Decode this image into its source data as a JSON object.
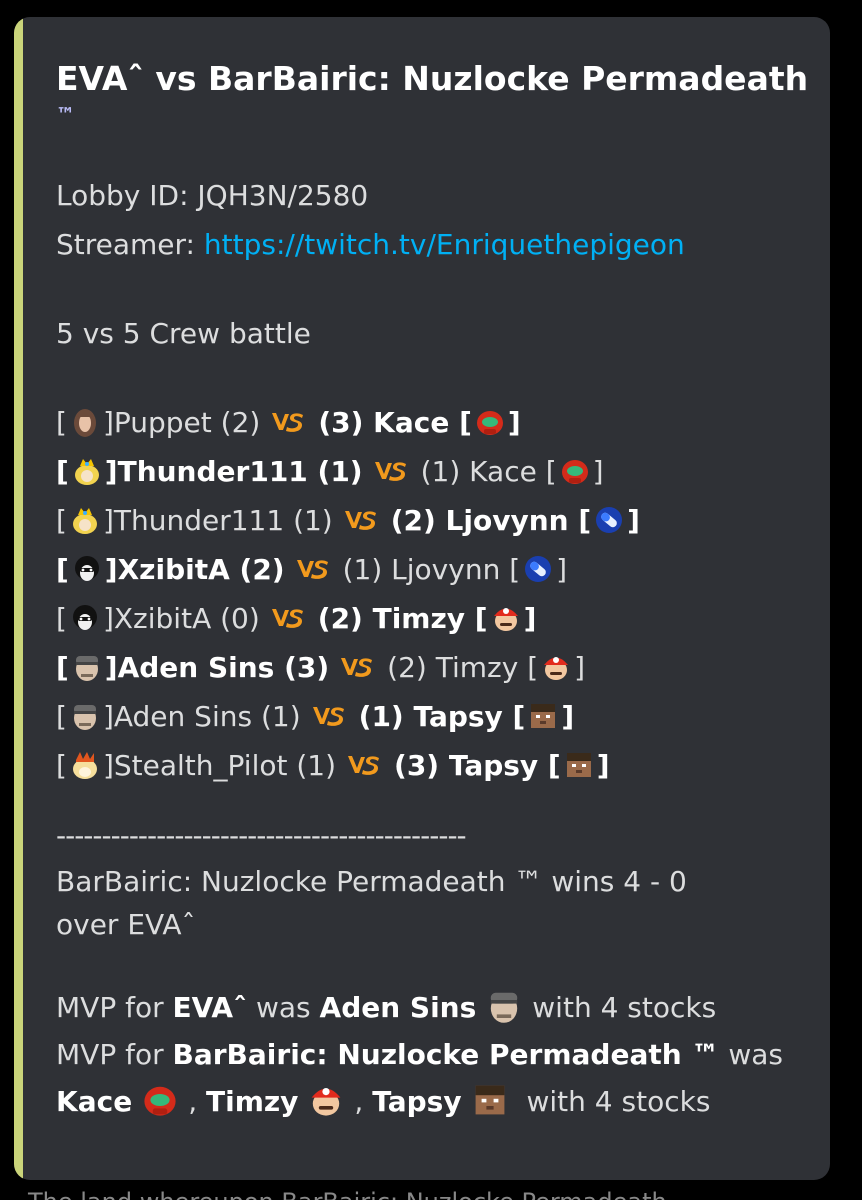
{
  "title": "EVAˆ vs BarBairic: Nuzlocke Permadeath",
  "title_tm": "™",
  "lobby": "Lobby ID: JQH3N/2580",
  "streamer_label": "Streamer: ",
  "streamer_url": "https://twitch.tv/Enriquethepigeon",
  "format": "5 vs 5 Crew battle",
  "matches": [
    {
      "left_name": "Puppet (2)",
      "left_bold": false,
      "left_icon": "hair-character-icon",
      "right_name": "(3) Kace",
      "right_bold": true,
      "right_icon": "samus-helmet-icon"
    },
    {
      "left_name": "Thunder111 (1)",
      "left_bold": true,
      "left_icon": "peach-crown-icon",
      "right_name": "(1) Kace",
      "right_bold": false,
      "right_icon": "samus-helmet-icon"
    },
    {
      "left_name": "Thunder111 (1)",
      "left_bold": false,
      "left_icon": "peach-crown-icon",
      "right_name": "(2) Ljovynn",
      "right_bold": true,
      "right_icon": "blue-capsule-icon"
    },
    {
      "left_name": "XzibitA (2)",
      "left_bold": true,
      "left_icon": "joker-mask-icon",
      "right_name": "(1) Ljovynn",
      "right_bold": false,
      "right_icon": "blue-capsule-icon"
    },
    {
      "left_name": "XzibitA (0)",
      "left_bold": false,
      "left_icon": "joker-mask-icon",
      "right_name": "(2) Timzy",
      "right_bold": true,
      "right_icon": "mario-cap-icon"
    },
    {
      "left_name": "Aden Sins (3)",
      "left_bold": true,
      "left_icon": "snake-bandana-icon",
      "right_name": "(2) Timzy",
      "right_bold": false,
      "right_icon": "mario-cap-icon"
    },
    {
      "left_name": "Aden Sins (1)",
      "left_bold": false,
      "left_icon": "snake-bandana-icon",
      "right_name": "(1) Tapsy",
      "right_bold": true,
      "right_icon": "steve-head-icon"
    },
    {
      "left_name": "Stealth_Pilot (1)",
      "left_bold": false,
      "left_icon": "bowser-head-icon",
      "right_name": "(3) Tapsy",
      "right_bold": true,
      "right_icon": "steve-head-icon"
    }
  ],
  "separator": "---------------------------------------------",
  "result_line1": "BarBairic: Nuzlocke Permadeath ™ wins 4 - 0",
  "result_line2": "over EVAˆ",
  "mvp": {
    "mvp_for": "MVP for ",
    "team1": "EVAˆ",
    "was": " was ",
    "team1_player": "Aden Sins",
    "with_stocks": "with 4 stocks",
    "team2": "BarBairic: Nuzlocke Permadeath ™",
    "was2": " was",
    "kace": "Kace",
    "timzy": "Timzy",
    "tapsy": "Tapsy",
    "comma": ","
  },
  "bottom_partial_text": "The land whereupon BarBairic: Nuzlocke Permadeath"
}
